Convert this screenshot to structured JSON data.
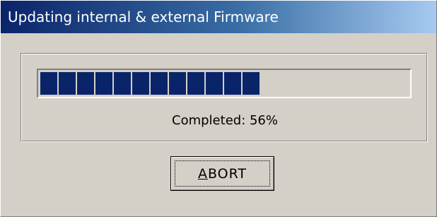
{
  "window": {
    "title": "Updating internal & external Firmware"
  },
  "progress": {
    "status_text": "Completed: 56%",
    "percent": 56,
    "filled_blocks": 12,
    "bar_color": "#0a246a"
  },
  "buttons": {
    "abort": {
      "mnemonic": "A",
      "rest": "BORT"
    }
  },
  "colors": {
    "face": "#d4d0c8",
    "title_start": "#0a246a",
    "title_end": "#a6caf0"
  }
}
